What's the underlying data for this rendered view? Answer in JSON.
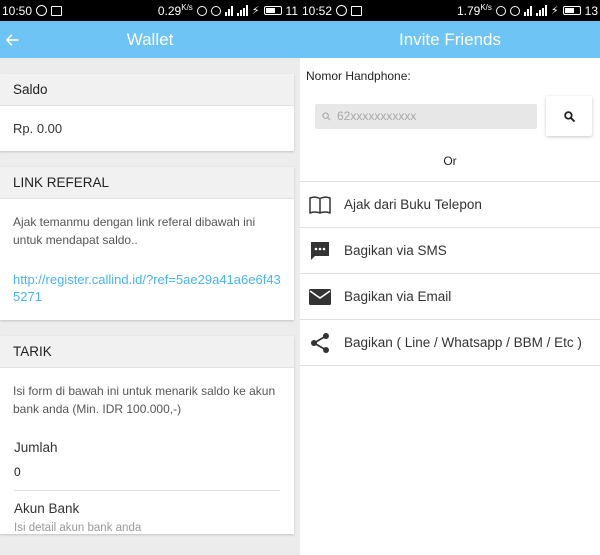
{
  "left": {
    "status": {
      "time": "10:50",
      "battery": "0.29",
      "time_right": "11"
    },
    "appbar": {
      "title": "Wallet"
    },
    "saldo": {
      "header": "Saldo",
      "value": "Rp. 0.00"
    },
    "referral": {
      "header": "LINK REFERAL",
      "description": "Ajak temanmu dengan link referal dibawah ini untuk mendapat saldo..",
      "link": "http://register.callind.id/?ref=5ae29a41a6e6f435271"
    },
    "tarik": {
      "header": "TARIK",
      "description": "Isi form di bawah ini untuk menarik saldo ke akun bank anda (Min. IDR 100.000,-)",
      "amount_label": "Jumlah",
      "amount_value": "0",
      "bank_label": "Akun Bank",
      "bank_placeholder": "Isi detail akun bank anda"
    }
  },
  "right": {
    "status": {
      "time": "10:52",
      "battery": "1.79",
      "time_right": "13"
    },
    "appbar": {
      "title": "Invite Friends"
    },
    "phone_label": "Nomor Handphone:",
    "phone_placeholder": "62xxxxxxxxxxx",
    "or_text": "Or",
    "menu": [
      {
        "label": "Ajak dari Buku Telepon",
        "icon": "book-icon"
      },
      {
        "label": "Bagikan via SMS",
        "icon": "sms-icon"
      },
      {
        "label": "Bagikan via Email",
        "icon": "email-icon"
      },
      {
        "label": "Bagikan ( Line / Whatsapp / BBM / Etc )",
        "icon": "share-icon"
      }
    ]
  }
}
